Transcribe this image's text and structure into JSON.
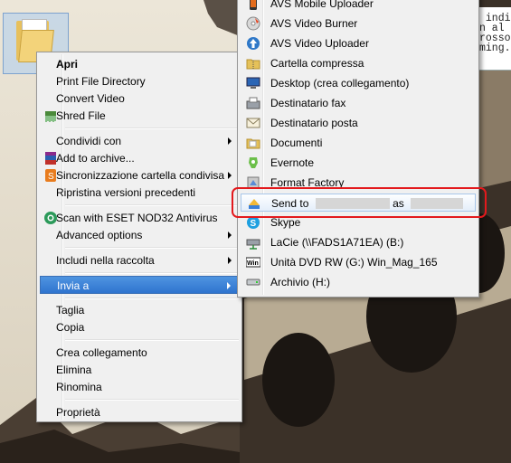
{
  "code_window": {
    "lines": [
      " indi",
      "n al",
      "rosso",
      "ming."
    ]
  },
  "context_menu": {
    "items": [
      {
        "label": "Apri",
        "bold": true
      },
      {
        "label": "Print File Directory"
      },
      {
        "label": "Convert Video"
      },
      {
        "label": "Shred File",
        "icon": "shredder-icon"
      },
      {
        "label": "Condividi con",
        "submenu": true
      },
      {
        "label": "Add to archive...",
        "icon": "winrar-icon"
      },
      {
        "label": "Sincronizzazione cartella condivisa",
        "icon": "sync-icon",
        "submenu": true
      },
      {
        "label": "Ripristina versioni precedenti"
      },
      {
        "label": "Scan with ESET NOD32 Antivirus",
        "icon": "eset-icon"
      },
      {
        "label": "Advanced options",
        "submenu": true
      },
      {
        "label": "Includi nella raccolta",
        "submenu": true
      },
      {
        "label": "Invia a",
        "submenu": true,
        "highlighted": true
      },
      {
        "label": "Taglia"
      },
      {
        "label": "Copia"
      },
      {
        "label": "Crea collegamento"
      },
      {
        "label": "Elimina"
      },
      {
        "label": "Rinomina"
      },
      {
        "label": "Proprietà"
      }
    ]
  },
  "send_to_menu": {
    "items": [
      {
        "label": "AVS Mobile Uploader",
        "icon": "avs-mobile-icon"
      },
      {
        "label": "AVS Video Burner",
        "icon": "avs-burner-icon"
      },
      {
        "label": "AVS Video Uploader",
        "icon": "avs-uploader-icon"
      },
      {
        "label": "Cartella compressa",
        "icon": "zip-folder-icon"
      },
      {
        "label": "Desktop (crea collegamento)",
        "icon": "desktop-icon"
      },
      {
        "label": "Destinatario fax",
        "icon": "fax-icon"
      },
      {
        "label": "Destinatario posta",
        "icon": "mail-icon"
      },
      {
        "label": "Documenti",
        "icon": "documents-icon"
      },
      {
        "label": "Evernote",
        "icon": "evernote-icon"
      },
      {
        "label": "Format Factory",
        "icon": "format-factory-icon"
      },
      {
        "label": "Send to",
        "label_suffix": "as",
        "icon": "send-to-icon",
        "highlighted": true,
        "annotated": true
      },
      {
        "label": "Skype",
        "icon": "skype-icon"
      },
      {
        "label": "LaCie (\\\\FADS1A71EA) (B:)",
        "icon": "network-drive-icon"
      },
      {
        "label": "Unità DVD RW (G:) Win_Mag_165",
        "icon": "dvd-icon"
      },
      {
        "label": "Archivio (H:)",
        "icon": "drive-icon"
      }
    ]
  },
  "colors": {
    "menu_bg": "#f0f0f0",
    "highlight": "#3a7fd8",
    "annotation": "#e3191c"
  }
}
